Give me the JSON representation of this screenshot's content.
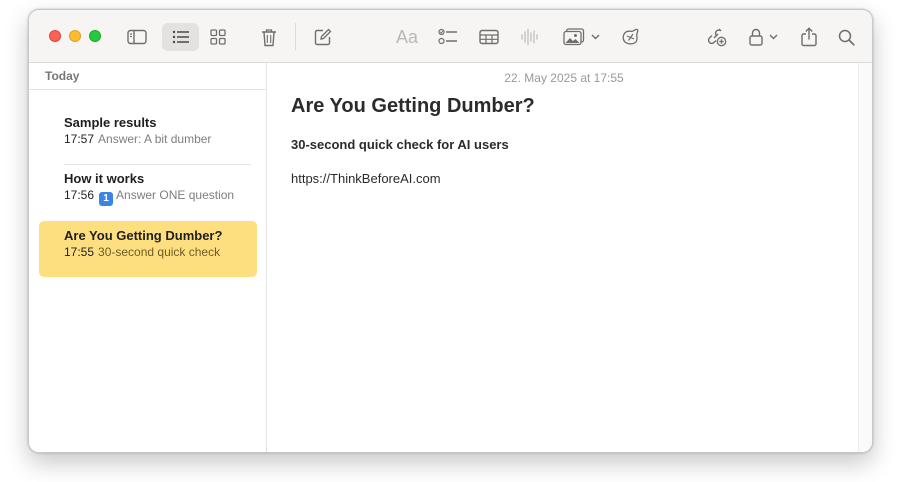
{
  "sidebar": {
    "section_header": "Today",
    "notes": [
      {
        "title": "Sample results",
        "time": "17:57",
        "preview": "Answer: A bit dumber"
      },
      {
        "title": "How it works",
        "time": "17:56",
        "badge": "1",
        "preview": "Answer ONE question"
      },
      {
        "title": "Are You Getting Dumber?",
        "time": "17:55",
        "preview": "30-second quick check"
      }
    ]
  },
  "editor": {
    "date": "22. May 2025 at 17:55",
    "title": "Are You Getting Dumber?",
    "subheading": "30-second quick check for AI users",
    "link": "https://ThinkBeforeAI.com"
  },
  "toolbar": {
    "icons": [
      "sidebar-toggle-icon",
      "list-view-icon",
      "gallery-view-icon",
      "trash-icon",
      "compose-icon",
      "format-text-icon",
      "checklist-icon",
      "table-icon",
      "audio-waveform-icon",
      "media-icon",
      "chevron-down-icon",
      "link-note-icon",
      "collaborate-icon",
      "lock-icon",
      "share-icon",
      "search-icon"
    ],
    "format_label": "Aa"
  },
  "colors": {
    "selected_note": "#fedf7f",
    "toolbar_bg": "#f6f5f3",
    "badge": "#3a85e6"
  }
}
